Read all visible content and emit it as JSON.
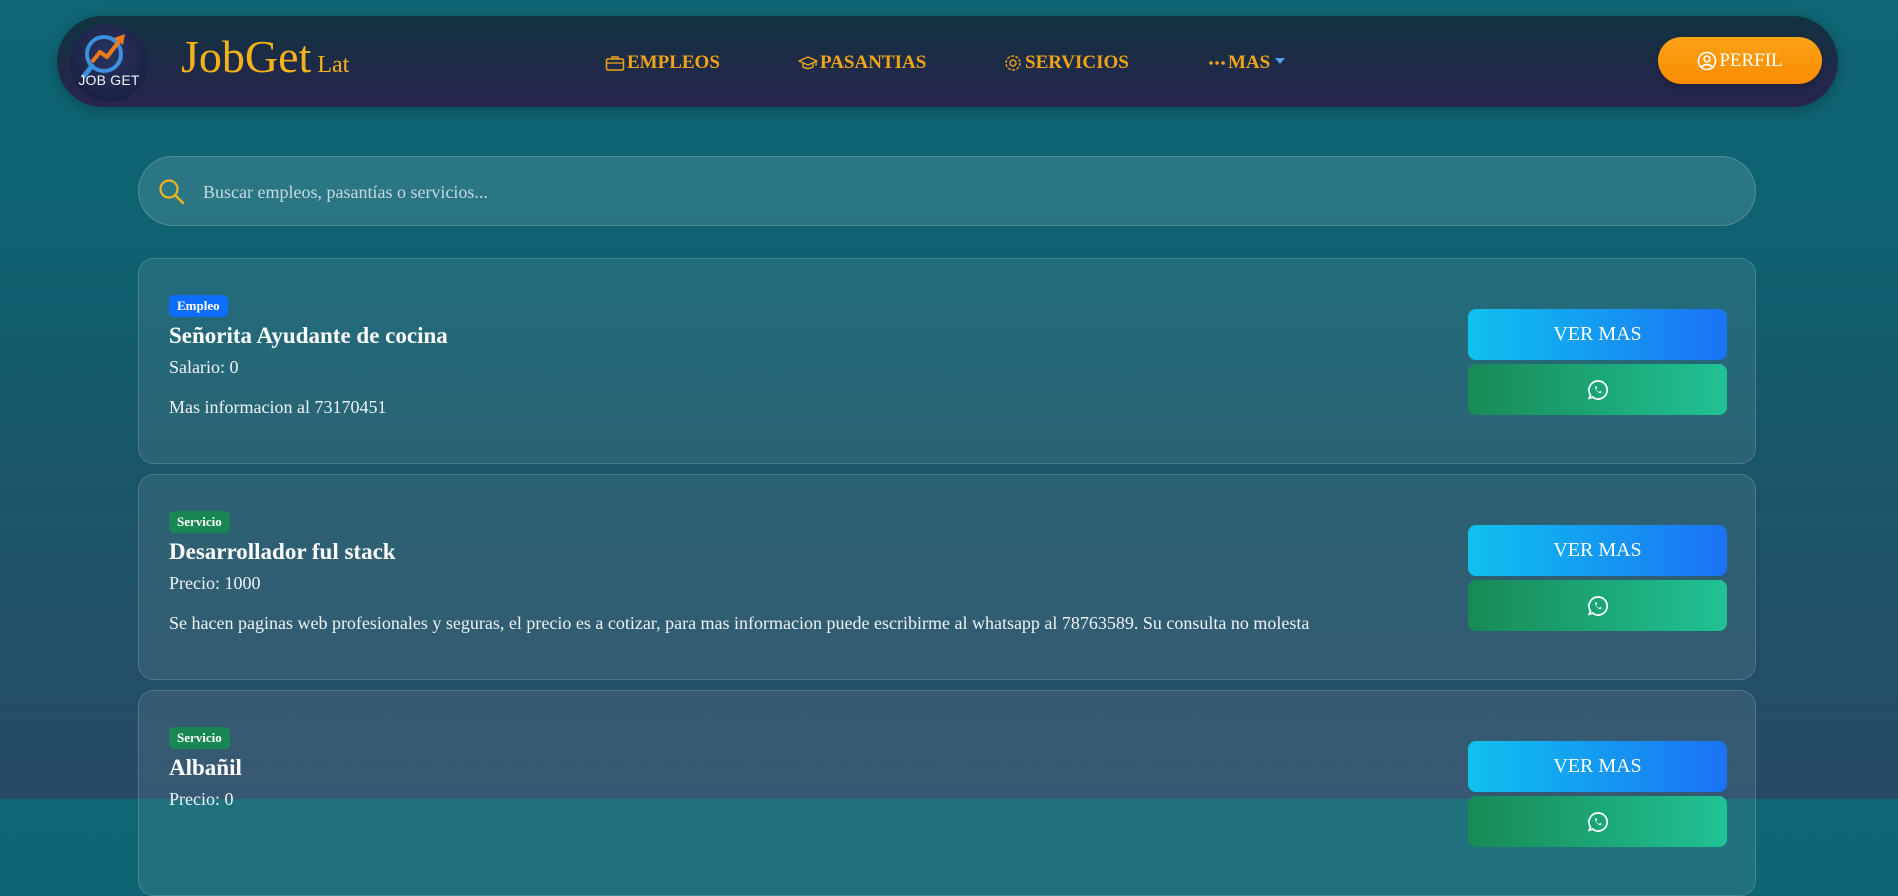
{
  "navbar": {
    "logo_text": "JOB GET",
    "brand_main": "JobGet",
    "brand_sub": "Lat",
    "items": [
      {
        "label": "EMPLEOS",
        "icon": "briefcase-icon"
      },
      {
        "label": "PASANTIAS",
        "icon": "graduation-cap-icon"
      },
      {
        "label": "SERVICIOS",
        "icon": "gear-icon"
      },
      {
        "label": "MAS",
        "icon": "dots-icon"
      }
    ],
    "profile_label": "PERFIL",
    "profile_icon": "user-circle-icon"
  },
  "search": {
    "placeholder": "Buscar empleos, pasantías o servicios...",
    "value": "",
    "icon": "search-icon"
  },
  "listings": [
    {
      "badge": "Empleo",
      "title": "Señorita Ayudante de cocina",
      "meta": "Salario: 0",
      "description": "Mas informacion al 73170451",
      "view_label": "VER MAS",
      "contact_icon": "whatsapp-icon"
    },
    {
      "badge": "Servicio",
      "title": "Desarrollador ful stack",
      "meta": "Precio: 1000",
      "description": "Se hacen paginas web profesionales y seguras, el precio es a cotizar, para mas informacion puede escribirme al whatsapp al 78763589. Su consulta no molesta",
      "view_label": "VER MAS",
      "contact_icon": "whatsapp-icon"
    },
    {
      "badge": "Servicio",
      "title": "Albañil",
      "meta": "Precio: 0",
      "description": "",
      "view_label": "VER MAS",
      "contact_icon": "whatsapp-icon"
    }
  ],
  "colors": {
    "accent_orange": "#f0a418",
    "brand_gold": "#f5b21a",
    "badge_empleo": "#0d6efd",
    "badge_servicio": "#198754"
  }
}
